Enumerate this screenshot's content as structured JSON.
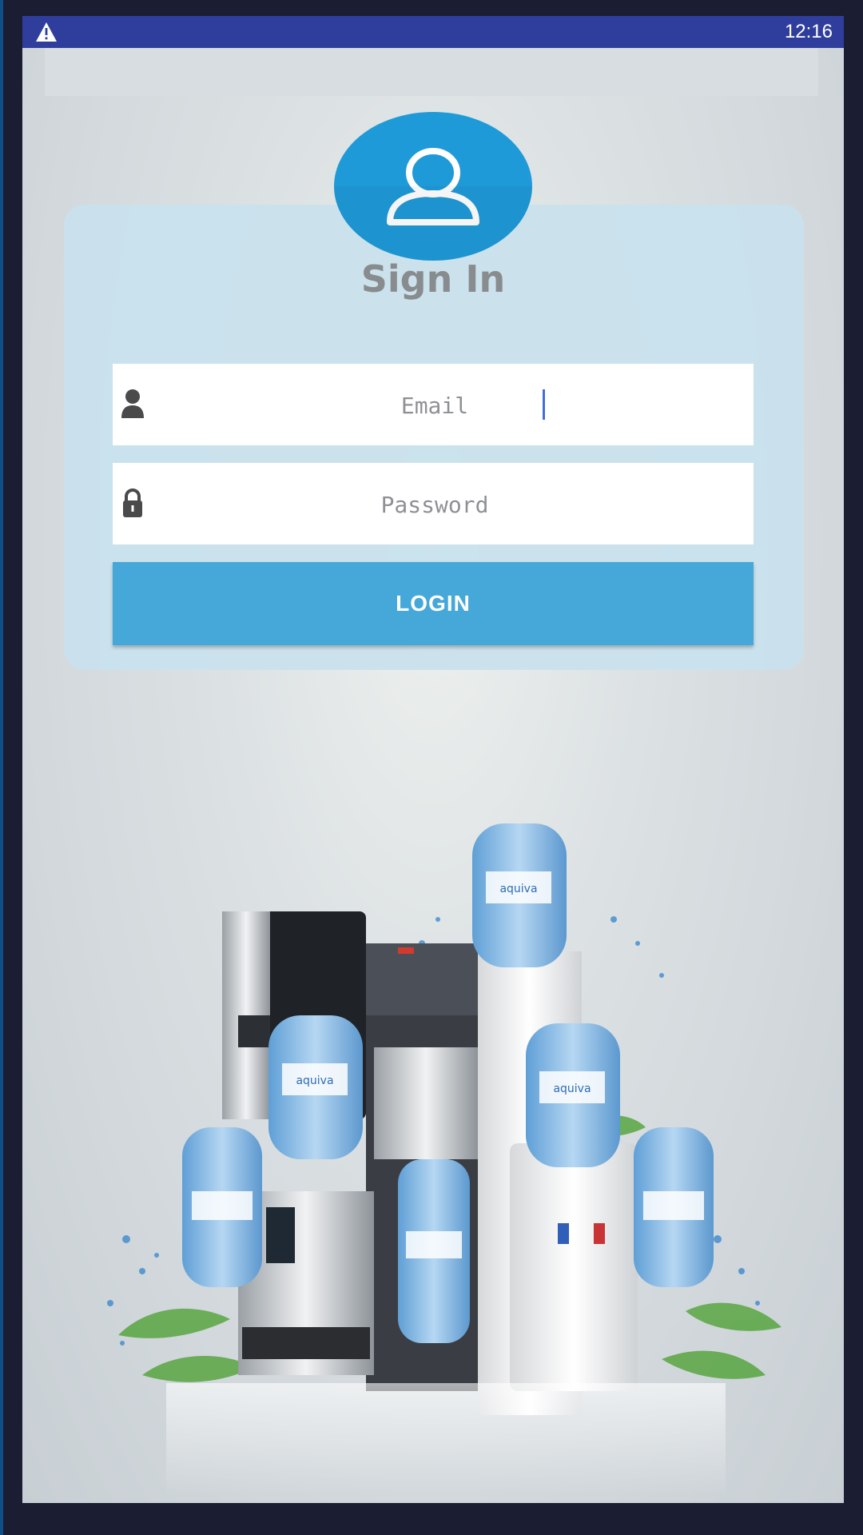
{
  "status_bar": {
    "time": "12:16",
    "warning_icon": "warning-icon"
  },
  "login": {
    "title": "Sign In",
    "email_placeholder": "Email",
    "password_placeholder": "Password",
    "login_button": "LOGIN",
    "avatar_icon": "user-icon",
    "email_icon": "person-icon",
    "password_icon": "lock-icon"
  },
  "hero": {
    "brand_label": "aquiva",
    "description": "water dispensers and bottles illustration"
  },
  "colors": {
    "status_bar": "#2f3e9c",
    "accent": "#45a8d8",
    "avatar": "#1f9ad8",
    "card": "#c9e2ed"
  }
}
